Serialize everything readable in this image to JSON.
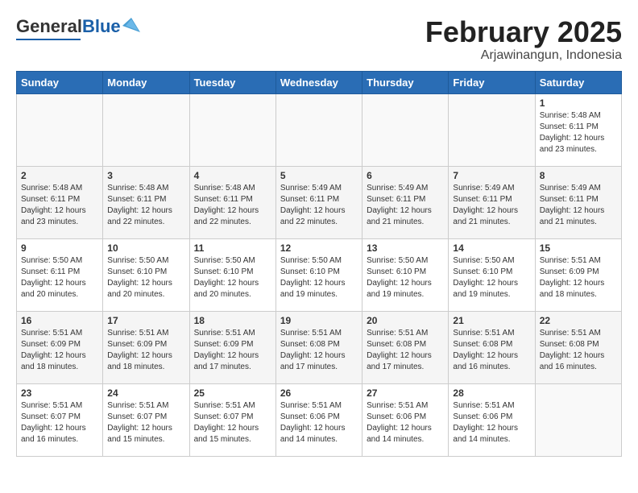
{
  "header": {
    "logo_general": "General",
    "logo_blue": "Blue",
    "title": "February 2025",
    "location": "Arjawinangun, Indonesia"
  },
  "calendar": {
    "days_of_week": [
      "Sunday",
      "Monday",
      "Tuesday",
      "Wednesday",
      "Thursday",
      "Friday",
      "Saturday"
    ],
    "weeks": [
      [
        {
          "day": "",
          "info": ""
        },
        {
          "day": "",
          "info": ""
        },
        {
          "day": "",
          "info": ""
        },
        {
          "day": "",
          "info": ""
        },
        {
          "day": "",
          "info": ""
        },
        {
          "day": "",
          "info": ""
        },
        {
          "day": "1",
          "info": "Sunrise: 5:48 AM\nSunset: 6:11 PM\nDaylight: 12 hours\nand 23 minutes."
        }
      ],
      [
        {
          "day": "2",
          "info": "Sunrise: 5:48 AM\nSunset: 6:11 PM\nDaylight: 12 hours\nand 23 minutes."
        },
        {
          "day": "3",
          "info": "Sunrise: 5:48 AM\nSunset: 6:11 PM\nDaylight: 12 hours\nand 22 minutes."
        },
        {
          "day": "4",
          "info": "Sunrise: 5:48 AM\nSunset: 6:11 PM\nDaylight: 12 hours\nand 22 minutes."
        },
        {
          "day": "5",
          "info": "Sunrise: 5:49 AM\nSunset: 6:11 PM\nDaylight: 12 hours\nand 22 minutes."
        },
        {
          "day": "6",
          "info": "Sunrise: 5:49 AM\nSunset: 6:11 PM\nDaylight: 12 hours\nand 21 minutes."
        },
        {
          "day": "7",
          "info": "Sunrise: 5:49 AM\nSunset: 6:11 PM\nDaylight: 12 hours\nand 21 minutes."
        },
        {
          "day": "8",
          "info": "Sunrise: 5:49 AM\nSunset: 6:11 PM\nDaylight: 12 hours\nand 21 minutes."
        }
      ],
      [
        {
          "day": "9",
          "info": "Sunrise: 5:50 AM\nSunset: 6:11 PM\nDaylight: 12 hours\nand 20 minutes."
        },
        {
          "day": "10",
          "info": "Sunrise: 5:50 AM\nSunset: 6:10 PM\nDaylight: 12 hours\nand 20 minutes."
        },
        {
          "day": "11",
          "info": "Sunrise: 5:50 AM\nSunset: 6:10 PM\nDaylight: 12 hours\nand 20 minutes."
        },
        {
          "day": "12",
          "info": "Sunrise: 5:50 AM\nSunset: 6:10 PM\nDaylight: 12 hours\nand 19 minutes."
        },
        {
          "day": "13",
          "info": "Sunrise: 5:50 AM\nSunset: 6:10 PM\nDaylight: 12 hours\nand 19 minutes."
        },
        {
          "day": "14",
          "info": "Sunrise: 5:50 AM\nSunset: 6:10 PM\nDaylight: 12 hours\nand 19 minutes."
        },
        {
          "day": "15",
          "info": "Sunrise: 5:51 AM\nSunset: 6:09 PM\nDaylight: 12 hours\nand 18 minutes."
        }
      ],
      [
        {
          "day": "16",
          "info": "Sunrise: 5:51 AM\nSunset: 6:09 PM\nDaylight: 12 hours\nand 18 minutes."
        },
        {
          "day": "17",
          "info": "Sunrise: 5:51 AM\nSunset: 6:09 PM\nDaylight: 12 hours\nand 18 minutes."
        },
        {
          "day": "18",
          "info": "Sunrise: 5:51 AM\nSunset: 6:09 PM\nDaylight: 12 hours\nand 17 minutes."
        },
        {
          "day": "19",
          "info": "Sunrise: 5:51 AM\nSunset: 6:08 PM\nDaylight: 12 hours\nand 17 minutes."
        },
        {
          "day": "20",
          "info": "Sunrise: 5:51 AM\nSunset: 6:08 PM\nDaylight: 12 hours\nand 17 minutes."
        },
        {
          "day": "21",
          "info": "Sunrise: 5:51 AM\nSunset: 6:08 PM\nDaylight: 12 hours\nand 16 minutes."
        },
        {
          "day": "22",
          "info": "Sunrise: 5:51 AM\nSunset: 6:08 PM\nDaylight: 12 hours\nand 16 minutes."
        }
      ],
      [
        {
          "day": "23",
          "info": "Sunrise: 5:51 AM\nSunset: 6:07 PM\nDaylight: 12 hours\nand 16 minutes."
        },
        {
          "day": "24",
          "info": "Sunrise: 5:51 AM\nSunset: 6:07 PM\nDaylight: 12 hours\nand 15 minutes."
        },
        {
          "day": "25",
          "info": "Sunrise: 5:51 AM\nSunset: 6:07 PM\nDaylight: 12 hours\nand 15 minutes."
        },
        {
          "day": "26",
          "info": "Sunrise: 5:51 AM\nSunset: 6:06 PM\nDaylight: 12 hours\nand 14 minutes."
        },
        {
          "day": "27",
          "info": "Sunrise: 5:51 AM\nSunset: 6:06 PM\nDaylight: 12 hours\nand 14 minutes."
        },
        {
          "day": "28",
          "info": "Sunrise: 5:51 AM\nSunset: 6:06 PM\nDaylight: 12 hours\nand 14 minutes."
        },
        {
          "day": "",
          "info": ""
        }
      ]
    ]
  }
}
